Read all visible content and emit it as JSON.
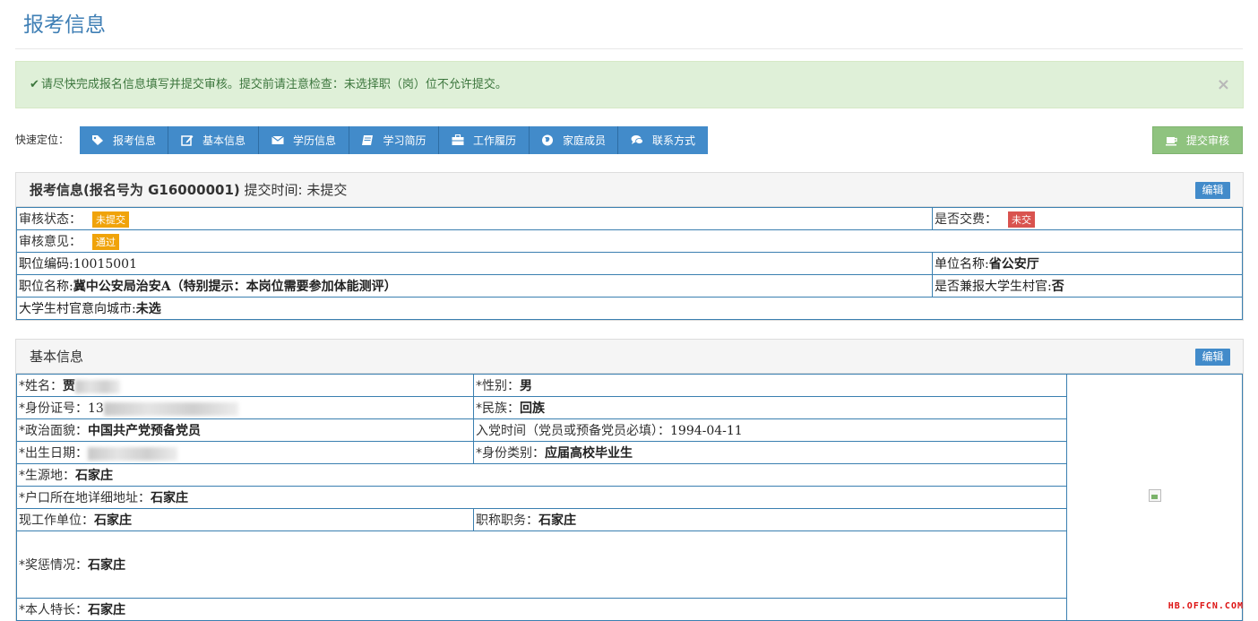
{
  "page": {
    "title": "报考信息"
  },
  "alert": {
    "message": "请尽快完成报名信息填写并提交审核。提交前请注意检查：未选择职（岗）位不允许提交。",
    "close": "×"
  },
  "quick_nav": {
    "label": "快速定位：",
    "items": [
      {
        "label": "报考信息",
        "icon": "tag-icon"
      },
      {
        "label": "基本信息",
        "icon": "edit-icon"
      },
      {
        "label": "学历信息",
        "icon": "envelope-icon"
      },
      {
        "label": "学习简历",
        "icon": "book-icon"
      },
      {
        "label": "工作履历",
        "icon": "briefcase-icon"
      },
      {
        "label": "家庭成员",
        "icon": "globe-icon"
      },
      {
        "label": "联系方式",
        "icon": "comments-icon"
      }
    ],
    "submit": "提交审核"
  },
  "apply_panel": {
    "title_prefix": "报考信息(报名号为 G16000001)",
    "title_suffix": " 提交时间: 未提交",
    "edit": "编辑",
    "review_status_label": "审核状态：",
    "review_status": "未提交",
    "paid_label": "是否交费：",
    "paid": "未交",
    "review_opinion_label": "审核意见：",
    "review_opinion": "通过",
    "position_code_label": "职位编码:",
    "position_code": "10015001",
    "unit_name_label": "单位名称:",
    "unit_name": "省公安厅",
    "position_name_label": "职位名称:",
    "position_name": "冀中公安局治安A（特别提示：本岗位需要参加体能测评）",
    "village_official_label": "是否兼报大学生村官:",
    "village_official": "否",
    "village_city_label": "大学生村官意向城市:",
    "village_city": "未选"
  },
  "basic_panel": {
    "title": "基本信息",
    "edit": "编辑",
    "name_label": "*姓名：",
    "name_visible": "贾",
    "gender_label": "*性别：",
    "gender": "男",
    "id_label": "*身份证号：",
    "id_visible": "13",
    "ethnicity_label": "*民族：",
    "ethnicity": "回族",
    "political_label": "*政治面貌：",
    "political": "中国共产党预备党员",
    "party_date_label": "入党时间（党员或预备党员必填）：",
    "party_date": "1994-04-11",
    "birth_label": "*出生日期：",
    "identity_label": "*身份类别：",
    "identity": "应届高校毕业生",
    "origin_label": "*生源地：",
    "origin": "石家庄",
    "hukou_label": "*户口所在地详细地址：",
    "hukou": "石家庄",
    "work_unit_label": "现工作单位：",
    "work_unit": "石家庄",
    "title_duty_label": "职称职务：",
    "title_duty": "石家庄",
    "rewards_label": "*奖惩情况：",
    "rewards": "石家庄",
    "specialty_label": "*本人特长：",
    "specialty": "石家庄"
  },
  "watermark": "HB.OFFCN.COM"
}
